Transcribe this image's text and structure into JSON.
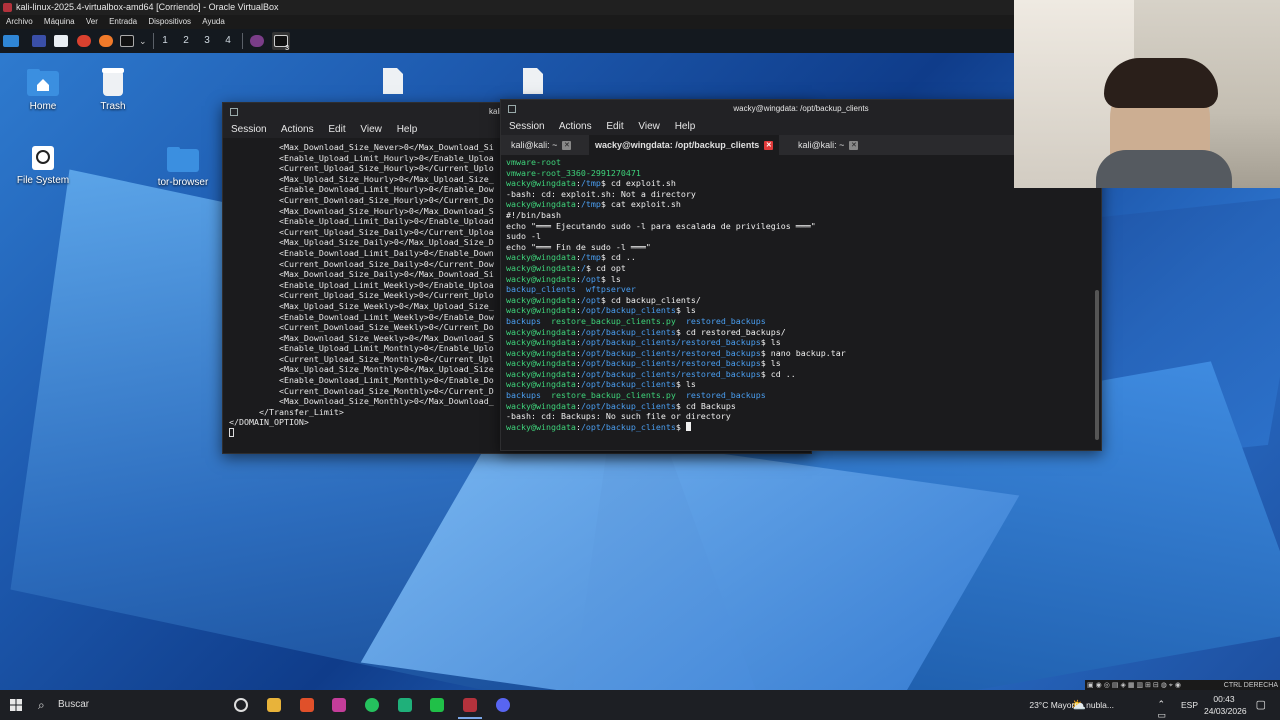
{
  "vbox": {
    "title": "kali-linux-2025.4-virtualbox-amd64 [Corriendo] - Oracle VirtualBox",
    "menu": [
      "Archivo",
      "Máquina",
      "Ver",
      "Entrada",
      "Dispositivos",
      "Ayuda"
    ],
    "host_key": "CTRL DERECHA"
  },
  "panel": {
    "workspaces": [
      "1",
      "2",
      "3",
      "4"
    ],
    "terminal_badge": "3"
  },
  "desktop": {
    "icons": [
      {
        "label": "Home",
        "icon": "home-folder-icon"
      },
      {
        "label": "Trash",
        "icon": "trash-icon"
      },
      {
        "label": "File System",
        "icon": "drive-icon"
      },
      {
        "label": "tor-browser",
        "icon": "folder-icon"
      }
    ]
  },
  "terminal_left": {
    "title": "kali",
    "menu": [
      "Session",
      "Actions",
      "Edit",
      "View",
      "Help"
    ],
    "lines": [
      "          <Max_Download_Size_Never>0</Max_Download_Si",
      "          <Enable_Upload_Limit_Hourly>0</Enable_Uploa",
      "          <Current_Upload_Size_Hourly>0</Current_Uplo",
      "          <Max_Upload_Size_Hourly>0</Max_Upload_Size_",
      "          <Enable_Download_Limit_Hourly>0</Enable_Dow",
      "          <Current_Download_Size_Hourly>0</Current_Do",
      "          <Max_Download_Size_Hourly>0</Max_Download_S",
      "          <Enable_Upload_Limit_Daily>0</Enable_Upload",
      "          <Current_Upload_Size_Daily>0</Current_Uploa",
      "          <Max_Upload_Size_Daily>0</Max_Upload_Size_D",
      "          <Enable_Download_Limit_Daily>0</Enable_Down",
      "          <Current_Download_Size_Daily>0</Current_Dow",
      "          <Max_Download_Size_Daily>0</Max_Download_Si",
      "          <Enable_Upload_Limit_Weekly>0</Enable_Uploa",
      "          <Current_Upload_Size_Weekly>0</Current_Uplo",
      "          <Max_Upload_Size_Weekly>0</Max_Upload_Size_",
      "          <Enable_Download_Limit_Weekly>0</Enable_Dow",
      "          <Current_Download_Size_Weekly>0</Current_Do",
      "          <Max_Download_Size_Weekly>0</Max_Download_S",
      "          <Enable_Upload_Limit_Monthly>0</Enable_Uplo",
      "          <Current_Upload_Size_Monthly>0</Current_Upl",
      "          <Max_Upload_Size_Monthly>0</Max_Upload_Size",
      "          <Enable_Download_Limit_Monthly>0</Enable_Do",
      "          <Current_Download_Size_Monthly>0</Current_D",
      "          <Max_Download_Size_Monthly>0</Max_Download_",
      "      </Transfer_Limit>",
      "</DOMAIN_OPTION>"
    ]
  },
  "terminal_right": {
    "title": "wacky@wingdata: /opt/backup_clients",
    "menu": [
      "Session",
      "Actions",
      "Edit",
      "View",
      "Help"
    ],
    "tabs": [
      "kali@kali: ~",
      "wacky@wingdata: /opt/backup_clients",
      "kali@kali: ~"
    ],
    "prompt_user": "wacky@wingdata",
    "lines": [
      {
        "type": "out_green",
        "text": "vmware-root"
      },
      {
        "type": "out_green",
        "text": "vmware-root_3360-2991270471"
      },
      {
        "type": "prompt",
        "path": "/tmp",
        "cmd": "cd exploit.sh"
      },
      {
        "type": "out",
        "text": "-bash: cd: exploit.sh: Not a directory"
      },
      {
        "type": "prompt",
        "path": "/tmp",
        "cmd": "cat exploit.sh"
      },
      {
        "type": "out",
        "text": "#!/bin/bash"
      },
      {
        "type": "out",
        "text": "echo \"═══ Ejecutando sudo -l para escalada de privilegios ═══\""
      },
      {
        "type": "out",
        "text": "sudo -l"
      },
      {
        "type": "out",
        "text": "echo \"═══ Fin de sudo -l ═══\""
      },
      {
        "type": "prompt",
        "path": "/tmp",
        "cmd": "cd .."
      },
      {
        "type": "prompt",
        "path": "/",
        "cmd": "cd opt"
      },
      {
        "type": "prompt",
        "path": "/opt",
        "cmd": "ls"
      },
      {
        "type": "out_blue",
        "text": "backup_clients  wftpserver"
      },
      {
        "type": "prompt",
        "path": "/opt",
        "cmd": "cd backup_clients/"
      },
      {
        "type": "prompt",
        "path": "/opt/backup_clients",
        "cmd": "ls"
      },
      {
        "type": "out_mixed",
        "text": "backups  restore_backup_clients.py  restored_backups"
      },
      {
        "type": "prompt",
        "path": "/opt/backup_clients",
        "cmd": "cd restored_backups/"
      },
      {
        "type": "prompt",
        "path": "/opt/backup_clients/restored_backups",
        "cmd": "ls"
      },
      {
        "type": "prompt",
        "path": "/opt/backup_clients/restored_backups",
        "cmd": "nano backup.tar"
      },
      {
        "type": "prompt",
        "path": "/opt/backup_clients/restored_backups",
        "cmd": "ls"
      },
      {
        "type": "prompt",
        "path": "/opt/backup_clients/restored_backups",
        "cmd": "cd .."
      },
      {
        "type": "prompt",
        "path": "/opt/backup_clients",
        "cmd": "ls"
      },
      {
        "type": "out_mixed",
        "text": "backups  restore_backup_clients.py  restored_backups"
      },
      {
        "type": "prompt",
        "path": "/opt/backup_clients",
        "cmd": "cd Backups"
      },
      {
        "type": "out",
        "text": "-bash: cd: Backups: No such file or directory"
      },
      {
        "type": "prompt_cursor",
        "path": "/opt/backup_clients",
        "cmd": ""
      }
    ]
  },
  "taskbar": {
    "search_placeholder": "Buscar",
    "weather": "23°C  Mayorm. nubla...",
    "lang": "ESP",
    "time": "00:43",
    "date": "24/03/2026"
  },
  "colors": {
    "prompt_green": "#3ed27a",
    "path_blue": "#4a9ef0",
    "close_red": "#e03a3a"
  }
}
